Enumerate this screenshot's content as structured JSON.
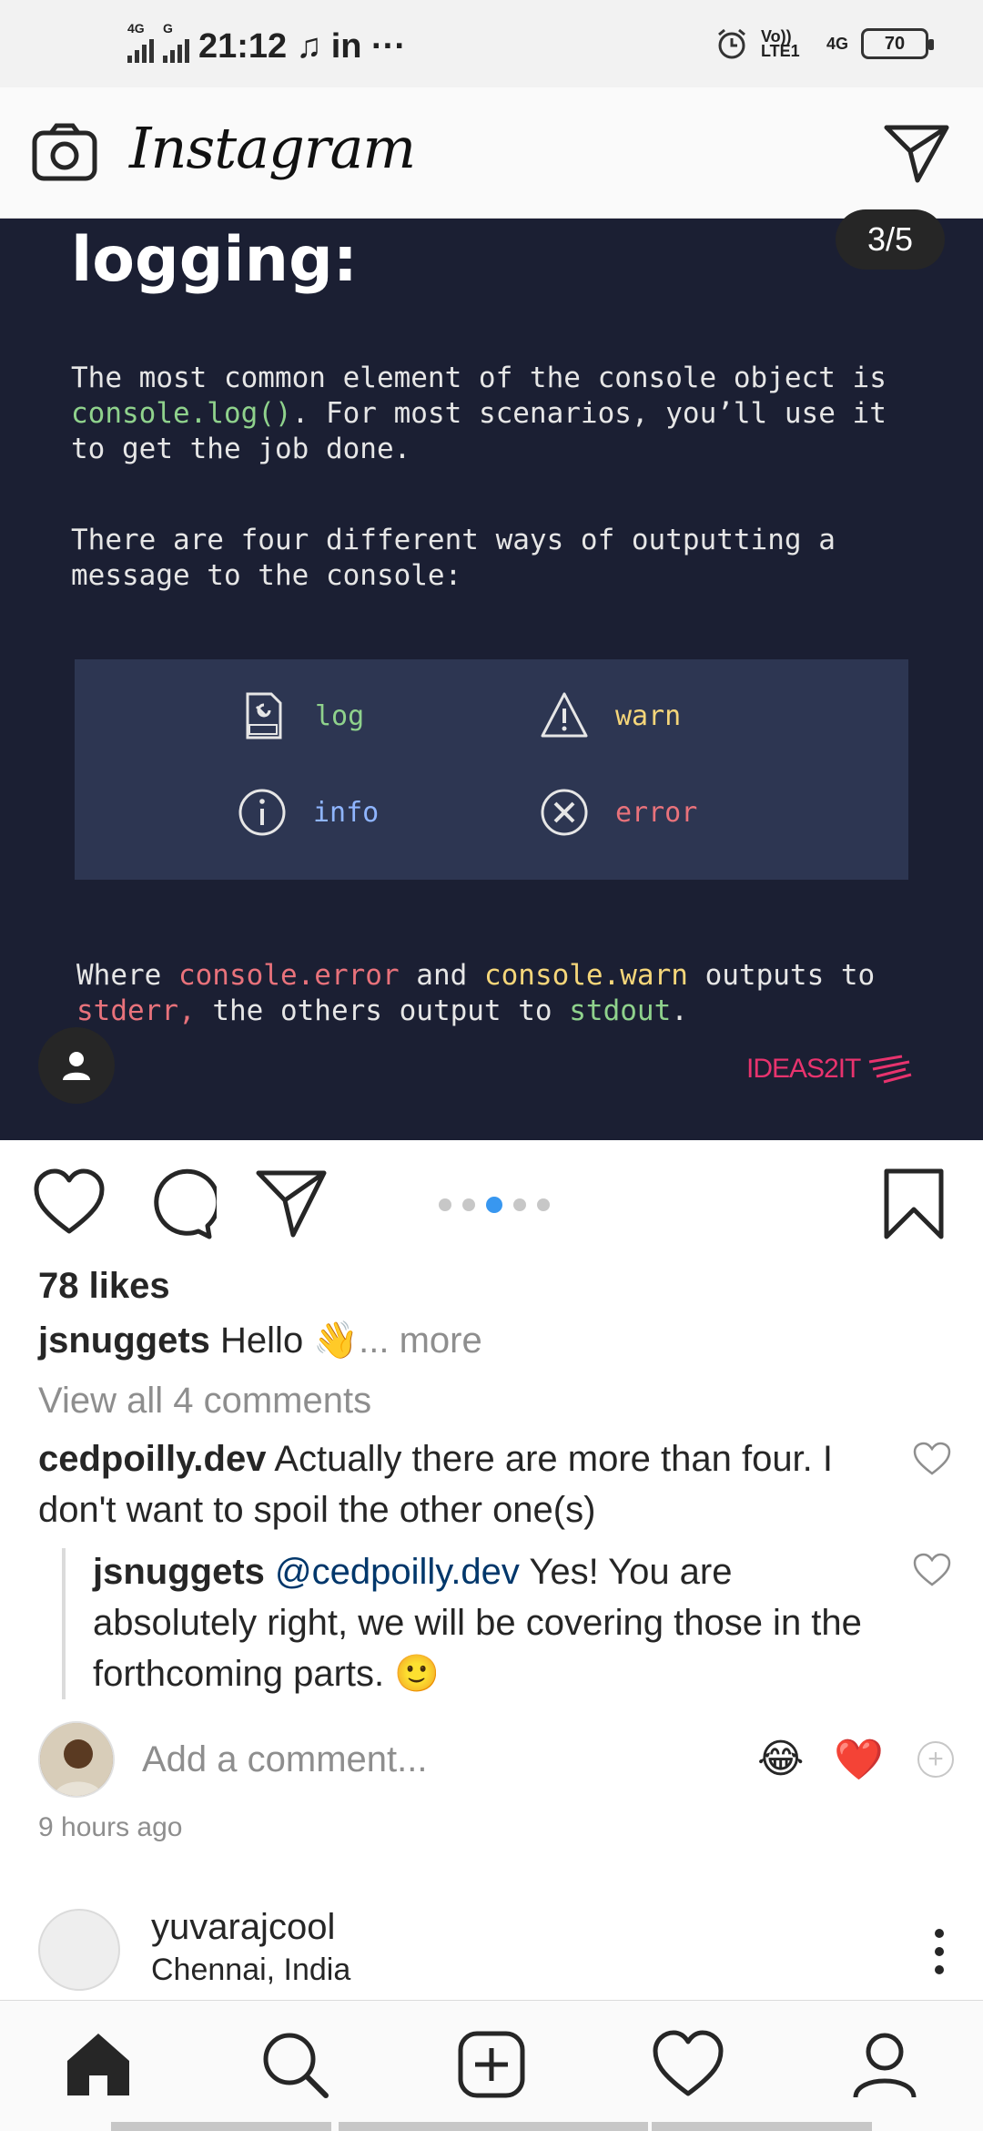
{
  "status_bar": {
    "network_1": "4G",
    "network_2": "G",
    "time": "21:12",
    "extra": "in ···",
    "volte": "Vo)) LTE1",
    "network_3": "4G",
    "battery": "70"
  },
  "header": {
    "brand": "Instagram"
  },
  "post": {
    "slide_counter": "3/5",
    "slide": {
      "title": "logging:",
      "para1_line1": "The most common element of the console object is",
      "para1_code": "console.log()",
      "para1_line2_rest": ". For most scenarios, you’ll use it",
      "para1_line3": "to get the job done.",
      "para2_line1": "There are four different ways of outputting a",
      "para2_line2": "message to the console:",
      "ways": {
        "log": "log",
        "warn": "warn",
        "info": "info",
        "error": "error"
      },
      "footer_l1_a": "Where ",
      "footer_l1_code1": "console.error",
      "footer_l1_b": " and ",
      "footer_l1_code2": "console.warn",
      "footer_l1_c": " outputs to",
      "footer_l2_code1": "stderr,",
      "footer_l2_a": " the others output to ",
      "footer_l2_code2": "stdout",
      "footer_l2_b": ".",
      "brand_mark": "IDEAS2IT"
    },
    "carousel": {
      "count": 5,
      "active_index": 2
    },
    "likes": "78 likes",
    "caption": {
      "user": "jsnuggets",
      "text": "Hello 👋",
      "more": "... more"
    },
    "view_all": "View all 4 comments",
    "comments": [
      {
        "user": "cedpoilly.dev",
        "text": "Actually there are more than four. I don't want to spoil the other one(s)"
      },
      {
        "user": "jsnuggets",
        "mention": "@cedpoilly.dev",
        "text": "Yes! You are absolutely right, we will be covering those in the forthcoming parts. 🙂"
      }
    ],
    "add_comment_placeholder": "Add a comment...",
    "quick_emojis": [
      "😂",
      "❤️"
    ],
    "time_ago": "9 hours ago"
  },
  "next_post": {
    "user": "yuvarajcool",
    "location": "Chennai, India"
  },
  "colors": {
    "slide_bg": "#1b1f33",
    "box_bg": "#2d3652",
    "accent_blue": "#3897f0",
    "brand_pink": "#e8336e"
  }
}
